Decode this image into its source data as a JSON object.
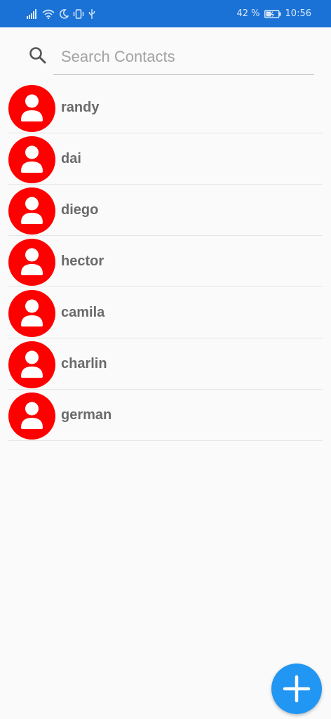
{
  "status_bar": {
    "battery_percent": "42 %",
    "time": "10:56",
    "icons": [
      "signal-icon",
      "wifi-icon",
      "moon-icon",
      "vibrate-icon",
      "usb-icon",
      "battery-icon"
    ]
  },
  "search": {
    "placeholder": "Search Contacts",
    "value": ""
  },
  "contacts": [
    {
      "name": "randy"
    },
    {
      "name": "dai"
    },
    {
      "name": "diego"
    },
    {
      "name": "hector"
    },
    {
      "name": "camila"
    },
    {
      "name": "charlin"
    },
    {
      "name": "german"
    }
  ],
  "colors": {
    "status_bar": "#1a72d6",
    "avatar": "#ff0000",
    "fab": "#2196f3"
  },
  "fab": {
    "icon": "plus-icon"
  }
}
